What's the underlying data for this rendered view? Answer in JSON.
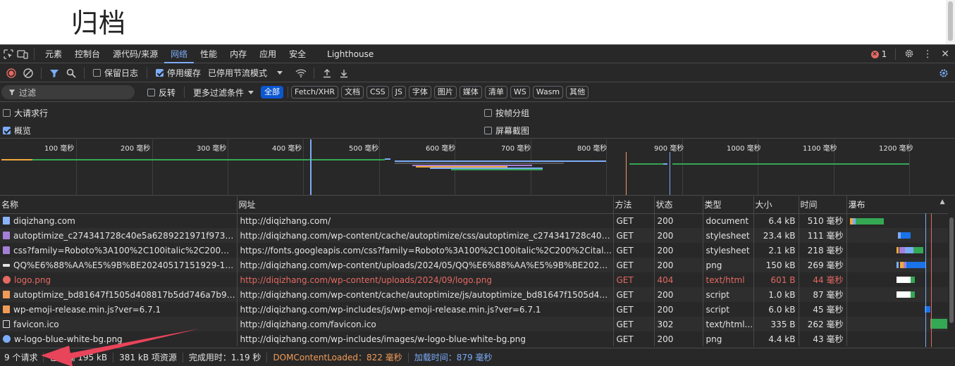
{
  "page": {
    "title": "归档"
  },
  "devtools": {
    "tabs": [
      "元素",
      "控制台",
      "源代码/来源",
      "网络",
      "性能",
      "内存",
      "应用",
      "安全",
      "Lighthouse"
    ],
    "active_tab": "网络",
    "error_count": "1"
  },
  "toolbar": {
    "preserve_log": "保留日志",
    "disable_cache": "停用缓存",
    "throttling": "已停用节流模式"
  },
  "filter": {
    "placeholder": "过滤",
    "invert": "反转",
    "more_filters": "更多过滤条件",
    "chips": [
      "全部",
      "Fetch/XHR",
      "文档",
      "CSS",
      "JS",
      "字体",
      "图片",
      "媒体",
      "清单",
      "WS",
      "Wasm",
      "其他"
    ]
  },
  "settings": {
    "large_rows": "大请求行",
    "group_by_frame": "按帧分组",
    "overview": "概览",
    "screenshots": "屏幕截图"
  },
  "overview": {
    "ticks": [
      "100 毫秒",
      "200 毫秒",
      "300 毫秒",
      "400 毫秒",
      "500 毫秒",
      "600 毫秒",
      "700 毫秒",
      "800 毫秒",
      "900 毫秒",
      "1000 毫秒",
      "1100 毫秒",
      "1200 毫秒"
    ]
  },
  "table": {
    "columns": [
      "名称",
      "网址",
      "方法",
      "状态",
      "类型",
      "大小",
      "时间",
      "瀑布"
    ],
    "rows": [
      {
        "name": "diqizhang.com",
        "url": "http://diqizhang.com/",
        "method": "GET",
        "status": "200",
        "type": "document",
        "size": "6.4 kB",
        "time": "510 毫秒",
        "icon": "document-icon",
        "error": false
      },
      {
        "name": "autoptimize_c274341728c40e5a6289221971f973a0.c...",
        "url": "http://diqizhang.com/wp-content/cache/autoptimize/css/autoptimize_c274341728c40e5...",
        "method": "GET",
        "status": "200",
        "type": "stylesheet",
        "size": "23.4 kB",
        "time": "111 毫秒",
        "icon": "stylesheet-icon",
        "error": false
      },
      {
        "name": "css?family=Roboto%3A100%2C100italic%2C200%2...",
        "url": "https://fonts.googleapis.com/css?family=Roboto%3A100%2C100italic%2C200%2Cital...",
        "method": "GET",
        "status": "200",
        "type": "stylesheet",
        "size": "2.1 kB",
        "time": "218 毫秒",
        "icon": "stylesheet-icon",
        "error": false
      },
      {
        "name": "QQ%E6%88%AA%E5%9B%BE20240517151929-102...",
        "url": "http://diqizhang.com/wp-content/uploads/2024/05/QQ%E6%88%AA%E5%9B%BE202405...",
        "method": "GET",
        "status": "200",
        "type": "png",
        "size": "150 kB",
        "time": "269 毫秒",
        "icon": "image-icon",
        "error": false
      },
      {
        "name": "logo.png",
        "url": "http://diqizhang.com/wp-content/uploads/2024/09/logo.png",
        "method": "GET",
        "status": "404",
        "type": "text/html",
        "size": "601 B",
        "time": "44 毫秒",
        "icon": "error-icon",
        "error": true
      },
      {
        "name": "autoptimize_bd81647f1505d408817b5dd746a7b96c.js",
        "url": "http://diqizhang.com/wp-content/cache/autoptimize/js/autoptimize_bd81647f1505d408...",
        "method": "GET",
        "status": "200",
        "type": "script",
        "size": "1.0 kB",
        "time": "87 毫秒",
        "icon": "script-icon",
        "error": false
      },
      {
        "name": "wp-emoji-release.min.js?ver=6.7.1",
        "url": "http://diqizhang.com/wp-includes/js/wp-emoji-release.min.js?ver=6.7.1",
        "method": "GET",
        "status": "200",
        "type": "script",
        "size": "6.0 kB",
        "time": "45 毫秒",
        "icon": "script-icon",
        "error": false
      },
      {
        "name": "favicon.ico",
        "url": "http://diqizhang.com/favicon.ico",
        "method": "GET",
        "status": "302",
        "type": "text/html...",
        "size": "335 B",
        "time": "262 毫秒",
        "icon": "file-icon",
        "error": false
      },
      {
        "name": "w-logo-blue-white-bg.png",
        "url": "http://diqizhang.com/wp-includes/images/w-logo-blue-white-bg.png",
        "method": "GET",
        "status": "200",
        "type": "png",
        "size": "4.4 kB",
        "time": "43 毫秒",
        "icon": "wordpress-icon",
        "error": false
      }
    ]
  },
  "status": {
    "requests": "9 个请求",
    "transferred": "已传输 195 kB",
    "resources": "381 kB 项资源",
    "finish": "完成用时：1.19 秒",
    "dcl": "DOMContentLoaded：822 毫秒",
    "load": "加载时间：879 毫秒"
  },
  "colors": {
    "accent": "#7cacf8",
    "error": "#e46962",
    "dcl": "#f29b57",
    "arrow": "#e8445a"
  }
}
